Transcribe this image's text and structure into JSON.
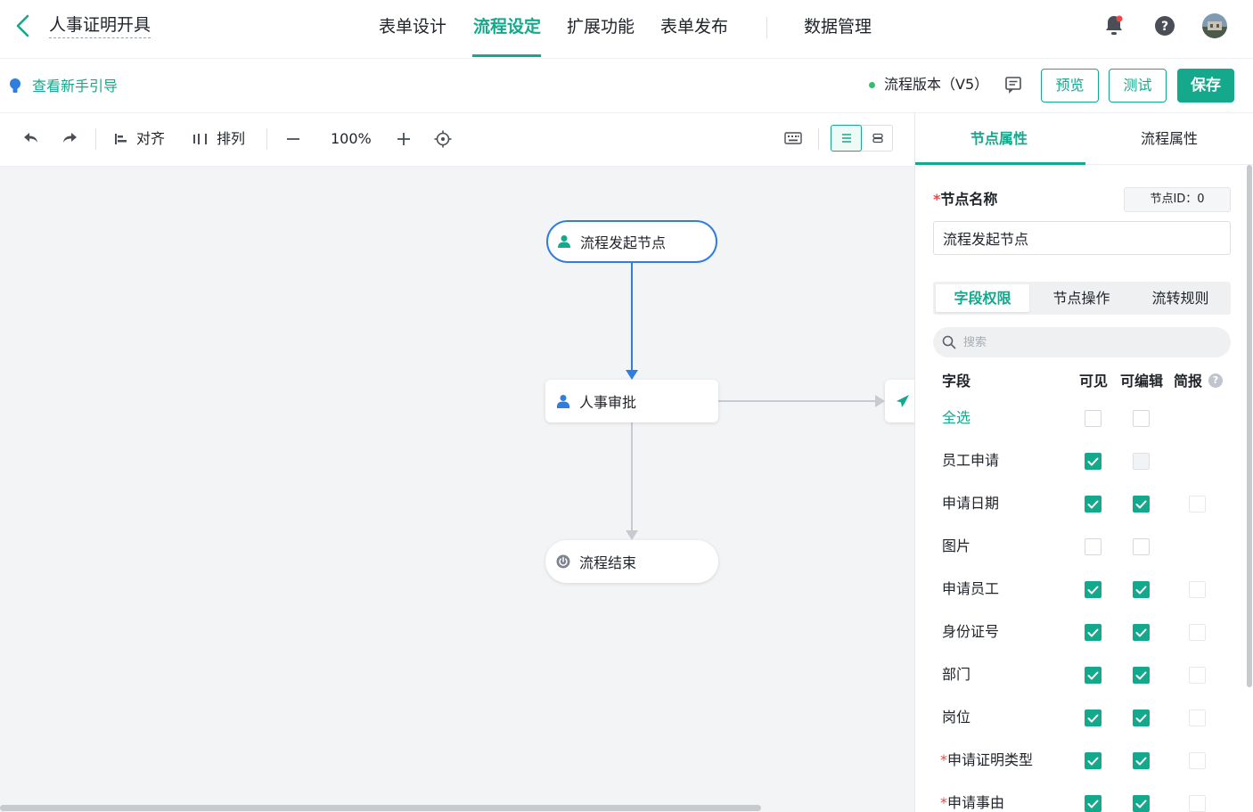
{
  "header": {
    "title": "人事证明开具",
    "nav": [
      {
        "label": "表单设计",
        "active": false
      },
      {
        "label": "流程设定",
        "active": true
      },
      {
        "label": "扩展功能",
        "active": false
      },
      {
        "label": "表单发布",
        "active": false
      },
      {
        "label": "数据管理",
        "active": false
      }
    ],
    "icons": [
      "bell-icon",
      "help-icon",
      "avatar"
    ]
  },
  "subheader": {
    "guide_label": "查看新手引导",
    "version_label": "流程版本（V5）",
    "preview_label": "预览",
    "test_label": "测试",
    "save_label": "保存"
  },
  "toolbar": {
    "align_label": "对齐",
    "arrange_label": "排列",
    "zoom": "100%"
  },
  "canvas": {
    "nodes": {
      "start": "流程发起节点",
      "approve": "人事审批",
      "end": "流程结束"
    }
  },
  "panel": {
    "tabs": [
      "节点属性",
      "流程属性"
    ],
    "active_tab": "节点属性",
    "node_name_label": "节点名称",
    "node_id": "节点ID：0",
    "node_name_value": "流程发起节点",
    "sub_tabs": [
      "字段权限",
      "节点操作",
      "流转规则"
    ],
    "search_placeholder": "搜索",
    "columns": [
      "字段",
      "可见",
      "可编辑",
      "简报"
    ],
    "select_all": "全选",
    "fields": [
      {
        "label": "员工申请",
        "required": false,
        "visible": true,
        "editable": false,
        "editable_disabled": true,
        "brief": null
      },
      {
        "label": "申请日期",
        "required": false,
        "visible": true,
        "editable": true,
        "brief": false
      },
      {
        "label": "图片",
        "required": false,
        "visible": false,
        "editable": false,
        "brief": null
      },
      {
        "label": "申请员工",
        "required": false,
        "visible": true,
        "editable": true,
        "brief": false
      },
      {
        "label": "身份证号",
        "required": false,
        "visible": true,
        "editable": true,
        "brief": false
      },
      {
        "label": "部门",
        "required": false,
        "visible": true,
        "editable": true,
        "brief": false
      },
      {
        "label": "岗位",
        "required": false,
        "visible": true,
        "editable": true,
        "brief": false
      },
      {
        "label": "申请证明类型",
        "required": true,
        "visible": true,
        "editable": true,
        "brief": false
      },
      {
        "label": "申请事由",
        "required": true,
        "visible": true,
        "editable": true,
        "brief": false
      }
    ]
  },
  "colors": {
    "accent": "#14a88c",
    "flow_blue": "#2f7de1",
    "canvas_bg": "#f3f4f6"
  }
}
